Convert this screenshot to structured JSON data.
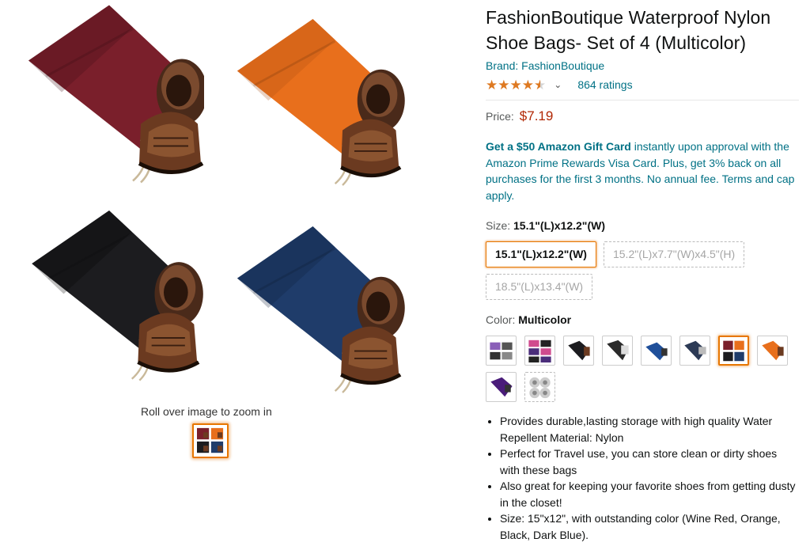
{
  "product": {
    "title": "FashionBoutique Waterproof Nylon Shoe Bags- Set of 4 (Multicolor)",
    "brand": "Brand: FashionBoutique",
    "rating": 4.5,
    "ratings_count": "864 ratings",
    "price_label": "Price:",
    "price": "$7.19"
  },
  "promo": {
    "bold": "Get a $50 Amazon Gift Card",
    "text": " instantly upon approval with the Amazon Prime Rewards Visa Card. Plus, get 3% back on all purchases for the first 3 months. No annual fee. Terms and cap apply."
  },
  "gallery": {
    "zoom_hint": "Roll over image to zoom in",
    "bag_colors": [
      "#7a1f2b",
      "#e86f1c",
      "#1c1c1f",
      "#1f3c6a"
    ]
  },
  "size": {
    "label": "Size: ",
    "selected": "15.1\"(L)x12.2\"(W)",
    "options": [
      {
        "label": "15.1\"(L)x12.2\"(W)",
        "state": "selected"
      },
      {
        "label": "15.2\"(L)x7.7\"(W)x4.5\"(H)",
        "state": "unavailable"
      },
      {
        "label": "18.5\"(L)x13.4\"(W)",
        "state": "unavailable"
      }
    ]
  },
  "color": {
    "label": "Color: ",
    "selected": "Multicolor",
    "swatches": [
      {
        "icon": "multicolor-bags-swatch"
      },
      {
        "icon": "pink-black-bags-swatch"
      },
      {
        "icon": "black-bag-swatch"
      },
      {
        "icon": "black-shoe-bag-swatch"
      },
      {
        "icon": "blue-bag-swatch"
      },
      {
        "icon": "navy-bags-swatch"
      },
      {
        "icon": "multicolor-bags-selected-swatch"
      },
      {
        "icon": "orange-bag-swatch"
      },
      {
        "icon": "purple-bag-swatch"
      },
      {
        "icon": "clear-bags-swatch"
      }
    ]
  },
  "bullets": [
    "Provides durable,lasting storage with high quality Water Repellent Material: Nylon",
    "Perfect for Travel use, you can store clean or dirty shoes with these bags",
    "Also great for keeping your favorite shoes from getting dusty in the closet!",
    "Size: 15\"x12\", with outstanding color (Wine Red, Orange, Black, Dark Blue)."
  ]
}
